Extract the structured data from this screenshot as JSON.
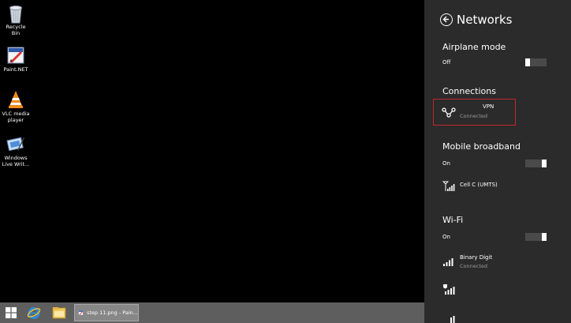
{
  "desktop": {
    "icons": [
      {
        "label": "Recycle Bin",
        "icon": "recycle-bin-icon"
      },
      {
        "label": "Paint.NET",
        "icon": "paint-net-icon"
      },
      {
        "label": "VLC media player",
        "icon": "vlc-icon"
      },
      {
        "label": "Windows Live Writ...",
        "icon": "windows-live-writer-icon"
      }
    ]
  },
  "taskbar": {
    "start_icon": "windows-logo-icon",
    "pinned": [
      "internet-explorer-icon",
      "file-explorer-icon"
    ],
    "active_task_label": "step 11.png - Pain..."
  },
  "networks_panel": {
    "title": "Networks",
    "airplane": {
      "heading": "Airplane mode",
      "state": "Off"
    },
    "connections": {
      "heading": "Connections",
      "vpn": {
        "name": "VPN",
        "status": "Connected"
      }
    },
    "mobile_broadband": {
      "heading": "Mobile broadband",
      "state": "On",
      "network": "Cell C (UMTS)"
    },
    "wifi": {
      "heading": "Wi-Fi",
      "state": "On",
      "networks": [
        {
          "name": "Binary Digit",
          "status": "Connected"
        }
      ]
    }
  },
  "colors": {
    "panel_bg": "#2b2b2b",
    "highlight": "#c0262e",
    "taskbar": "#5e5e5e"
  }
}
